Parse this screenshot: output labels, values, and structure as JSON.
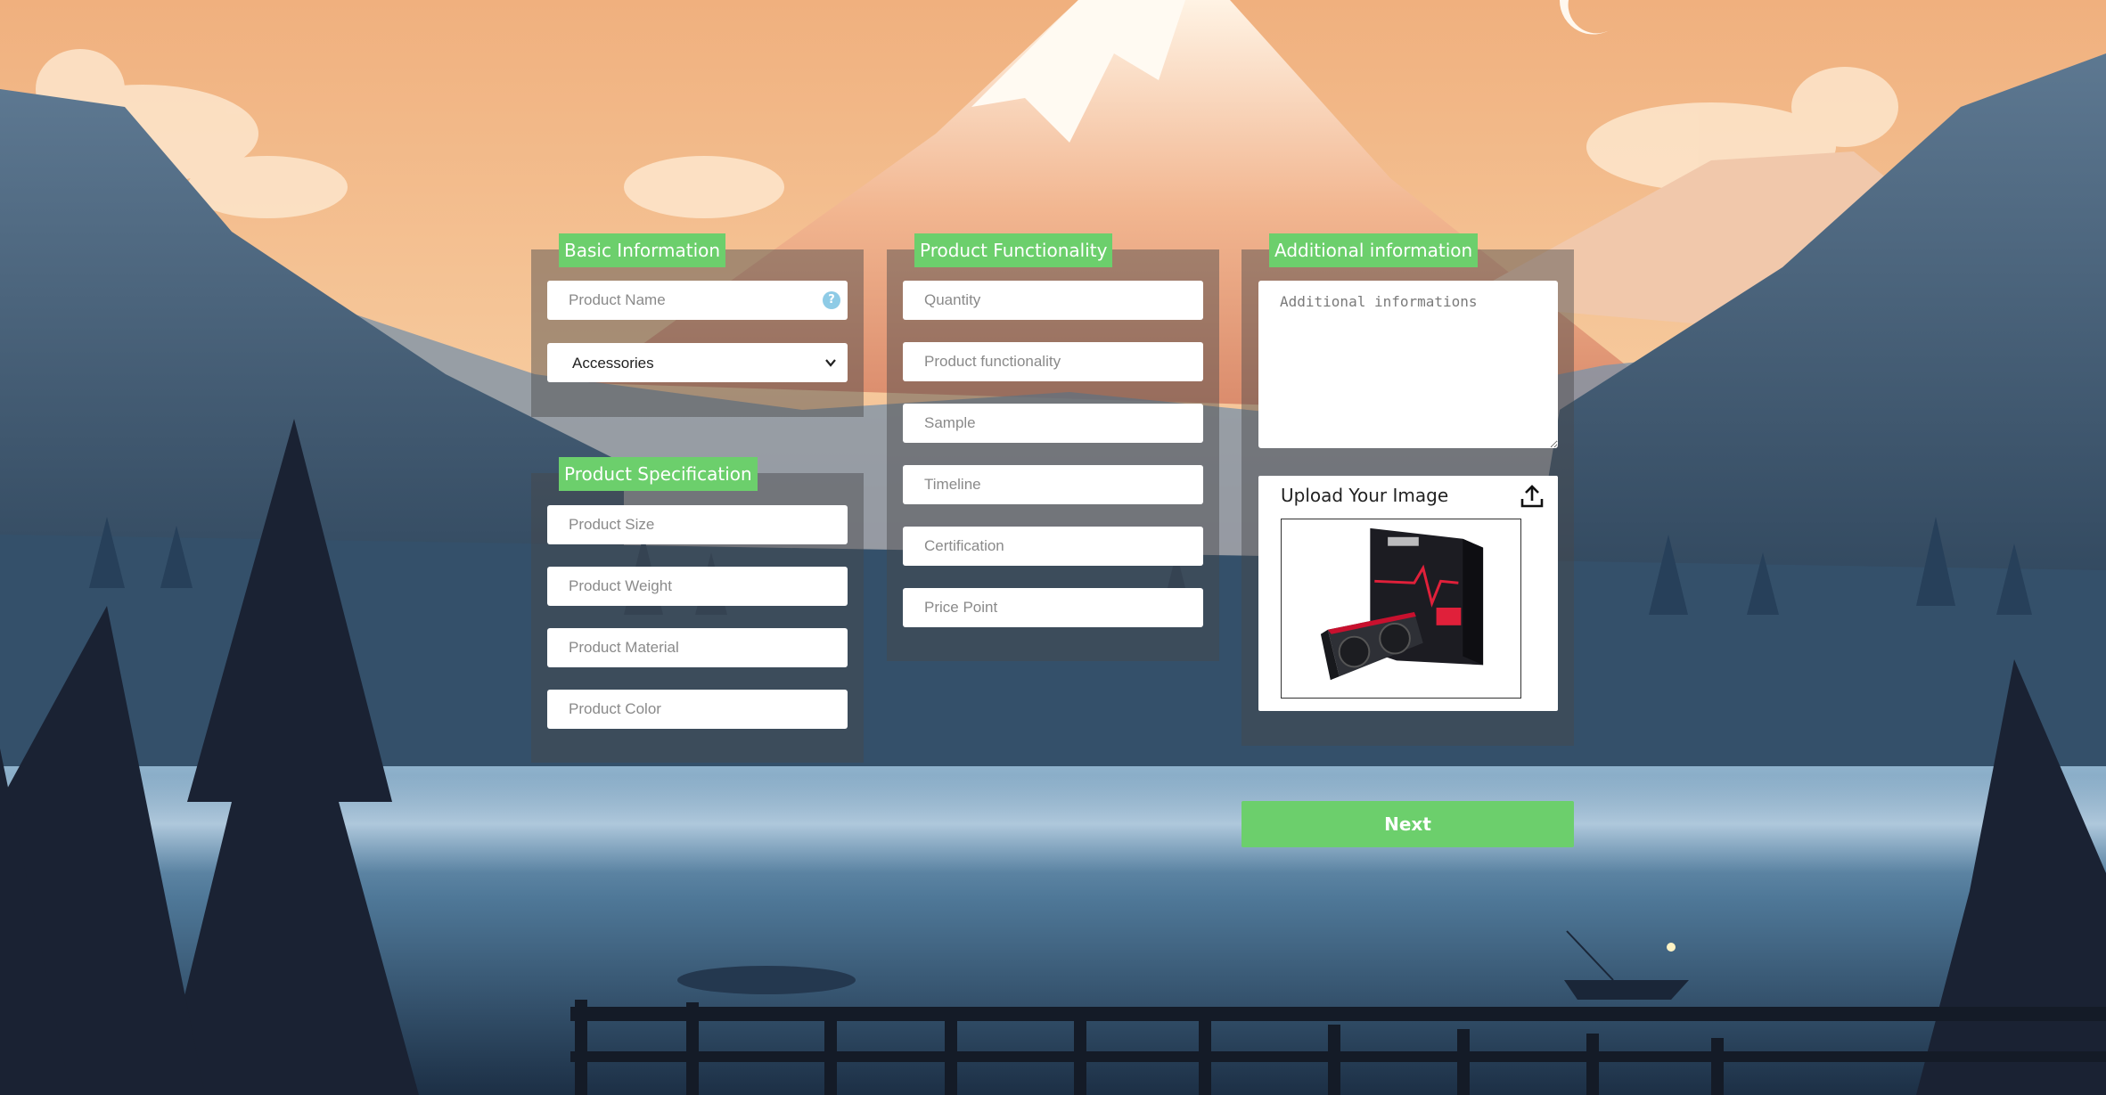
{
  "basic_info": {
    "title": "Basic Information",
    "product_name_placeholder": "Product Name",
    "category_selected": "Accessories"
  },
  "specification": {
    "title": "Product Specification",
    "size_placeholder": "Product Size",
    "weight_placeholder": "Product Weight",
    "material_placeholder": "Product Material",
    "color_placeholder": "Product Color"
  },
  "functionality": {
    "title": "Product Functionality",
    "quantity_placeholder": "Quantity",
    "functionality_placeholder": "Product functionality",
    "sample_placeholder": "Sample",
    "timeline_placeholder": "Timeline",
    "certification_placeholder": "Certification",
    "price_point_placeholder": "Price Point"
  },
  "additional": {
    "title": "Additional information",
    "textarea_placeholder": "Additional informations"
  },
  "upload": {
    "title": "Upload Your Image",
    "icon": "upload-icon"
  },
  "actions": {
    "next_label": "Next"
  },
  "colors": {
    "accent_green": "#6ccf6c",
    "panel_bg": "rgba(70,72,74,0.45)",
    "help_icon": "#8ecbe6"
  }
}
